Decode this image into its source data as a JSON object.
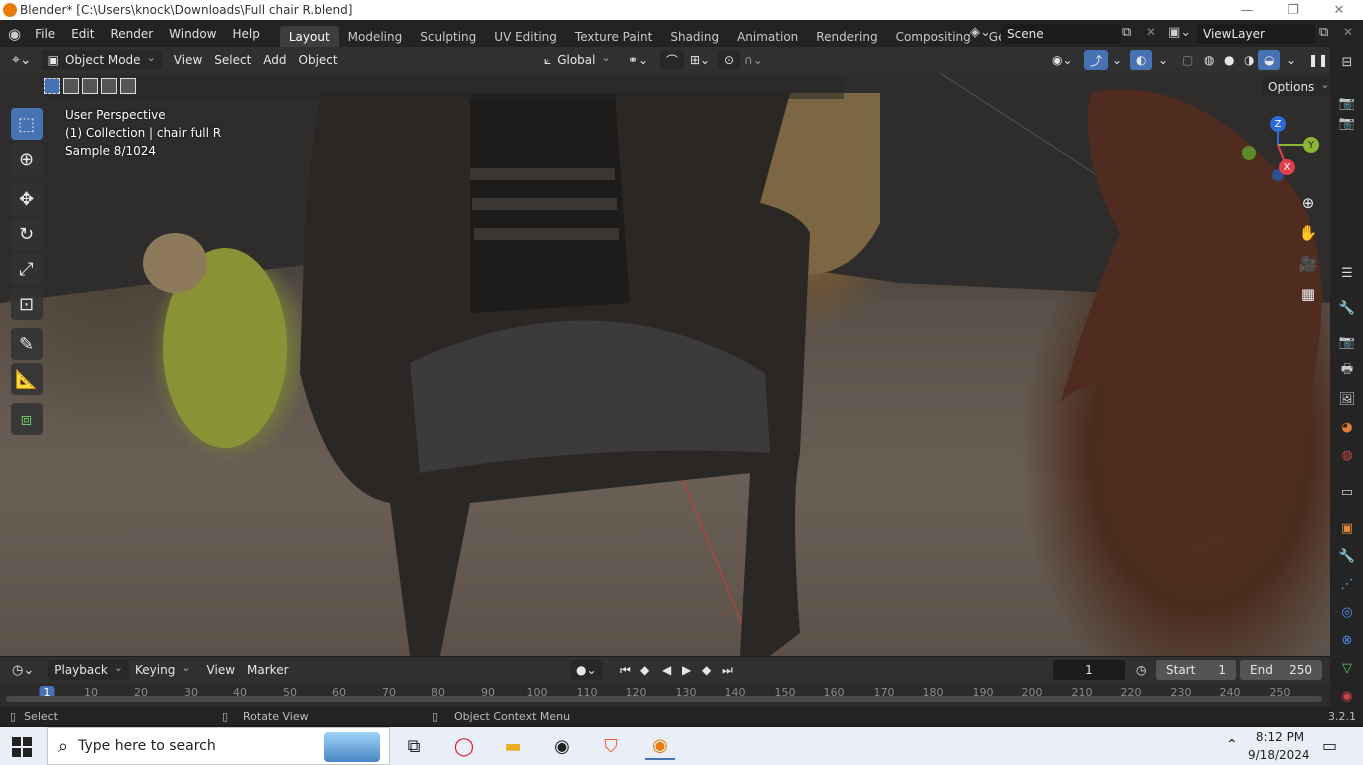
{
  "window": {
    "title": "Blender* [C:\\Users\\knock\\Downloads\\Full chair R.blend]"
  },
  "topbar": {
    "menus": [
      "File",
      "Edit",
      "Render",
      "Window",
      "Help"
    ],
    "workspaces": [
      "Layout",
      "Modeling",
      "Sculpting",
      "UV Editing",
      "Texture Paint",
      "Shading",
      "Animation",
      "Rendering",
      "Compositing",
      "Geometry Noc"
    ],
    "active_workspace": "Layout",
    "scene": "Scene",
    "view_layer": "ViewLayer"
  },
  "viewport_header": {
    "mode": "Object Mode",
    "menus": [
      "View",
      "Select",
      "Add",
      "Object"
    ],
    "transform_orientation": "Global",
    "options": "Options"
  },
  "viewport_overlay": {
    "line1": "User Perspective",
    "line2": "(1) Collection | chair full R",
    "line3": "Sample 8/1024"
  },
  "gizmo": {
    "z": "Z",
    "y": "Y",
    "x": "X"
  },
  "timeline": {
    "menus": [
      "Playback",
      "Keying",
      "View",
      "Marker"
    ],
    "current_frame": "1",
    "start_label": "Start",
    "start": "1",
    "end_label": "End",
    "end": "250",
    "ticks": [
      "1",
      "10",
      "20",
      "30",
      "40",
      "50",
      "60",
      "70",
      "80",
      "90",
      "100",
      "110",
      "120",
      "130",
      "140",
      "150",
      "160",
      "170",
      "180",
      "190",
      "200",
      "210",
      "220",
      "230",
      "240",
      "250"
    ]
  },
  "statusbar": {
    "select": "Select",
    "rotate": "Rotate View",
    "context": "Object Context Menu",
    "version": "3.2.1"
  },
  "taskbar": {
    "search_placeholder": "Type here to search",
    "time": "8:12 PM",
    "date": "9/18/2024"
  },
  "colors": {
    "accent": "#4772b3",
    "active_tool": "#4772b3",
    "frame_marker": "#4772b3"
  }
}
